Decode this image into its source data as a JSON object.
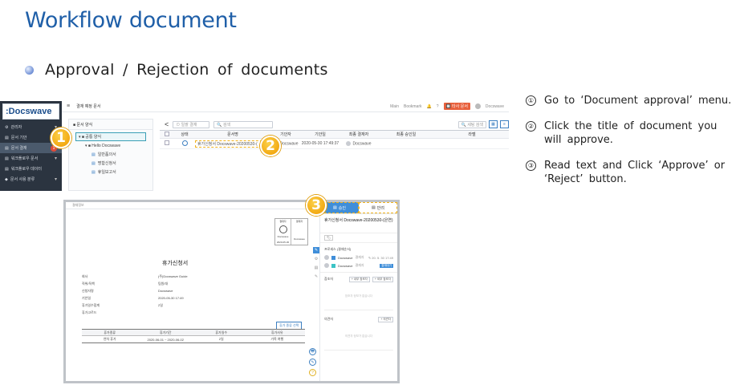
{
  "slide": {
    "title": "Workflow document",
    "bullet": "Approval  / Rejection  of  documents"
  },
  "steps": [
    {
      "num": "①",
      "text": "Go to ‘Document  approval’ menu."
    },
    {
      "num": "②",
      "text": "Click the title of document you will approve."
    },
    {
      "num": "③",
      "text": "Read text and Click ‘Approve’ or ‘Reject’ button."
    }
  ],
  "callouts": {
    "one": "1",
    "two": "2",
    "three": "3"
  },
  "app": {
    "logo": ":Docswave",
    "sidebar": [
      {
        "label": "관리자",
        "chev": "▾"
      },
      {
        "label": "문서 기안",
        "chev": ""
      },
      {
        "label": "문서 결재",
        "chev": "",
        "badge": "1",
        "active": true
      },
      {
        "label": "워크플로우 문서",
        "chev": "▾"
      },
      {
        "label": "워크플로우 데이터",
        "chev": ""
      },
      {
        "label": "문서 사용 분류",
        "chev": "▾"
      }
    ],
    "topbar": {
      "menu_icon": "≡",
      "page_name": "결재 예정 문서",
      "links": [
        "Main",
        "Bookmark"
      ],
      "bell": "🔔",
      "help": "?",
      "red_button": "🔲 타사 문서",
      "user": "Docswave"
    },
    "tree": {
      "header": "■ 문서 양식",
      "items": [
        "▾ ■ 공통 양식",
        "▾ ■ Hello Docswave",
        "일반품의서",
        "명함신청서",
        "휴일보고서"
      ]
    },
    "toolbar": {
      "nav_prev": "<",
      "status_select": "⊙ 일괄 결재",
      "search": "🔍 검색",
      "right_button": "🔍 세팅 검색"
    },
    "grid": {
      "headers": [
        "",
        "상태",
        "문서명",
        "기안자",
        "기안일",
        "최종 결재자",
        "최종 승인일",
        "라벨"
      ],
      "rows": [
        {
          "title": "휴가신청서 Docswave-20200530-(",
          "drafter": "Docswave",
          "date": "2020-05-30 17:49:37",
          "final": "Docswave",
          "approved": "",
          "label": ""
        }
      ]
    }
  },
  "detail": {
    "top_label": "결재정보",
    "stamp": {
      "col1": "결재자",
      "col2": "결재자",
      "name1": "Docswave",
      "name2": "Docswave",
      "date1": "2020-05-30",
      "date2": ""
    },
    "doc_title": "휴가신청서",
    "fields": [
      {
        "label": "회사",
        "value": "(주)Docswave Guide"
      },
      {
        "label": "직위/직책",
        "value": "팀원/대"
      },
      {
        "label": "신청자명",
        "value": "Docswave"
      },
      {
        "label": "기안일",
        "value": "2020-05-30 17:49"
      },
      {
        "label": "휴가일수합계",
        "value": "2일"
      },
      {
        "label": "휴가고르드",
        "value": ""
      }
    ],
    "add_button": "휴가 종류 선택",
    "table": {
      "headers": [
        "휴가종류",
        "휴가기간",
        "휴가일수",
        "휴가사유"
      ],
      "rows": [
        [
          "연차 휴가",
          "2020-06-01 ~ 2020-06-02",
          "2일",
          "가족 여행"
        ]
      ]
    },
    "float_icons": [
      "🖶",
      "✎",
      "?"
    ],
    "side_tools": [
      "✎",
      "⚙",
      "▤",
      "✎"
    ],
    "panel": {
      "approve_label": "승인",
      "reject_label": "반려",
      "doc_title": "휴가신청서 Docswave-20200530-(은연)",
      "tag_icon": "🏷",
      "process_label": "프로세스 (결재순서)",
      "approver1": {
        "name": "Docswave",
        "role": "결재자",
        "meta": "✎ 20. 5. 30 17:49"
      },
      "approver2": {
        "name": "Docswave",
        "role": "결재자",
        "pill": "결재대기"
      },
      "cc_label": "참조자",
      "cc_btn1": "+ 내부 참조자",
      "cc_btn2": "+ 외부 참조자",
      "cc_empty": "참조자 정보가 없습니다",
      "opinion_label": "의견자",
      "opinion_btn": "+ 의견자",
      "opinion_empty": "의견자 정보가 없습니다"
    }
  }
}
